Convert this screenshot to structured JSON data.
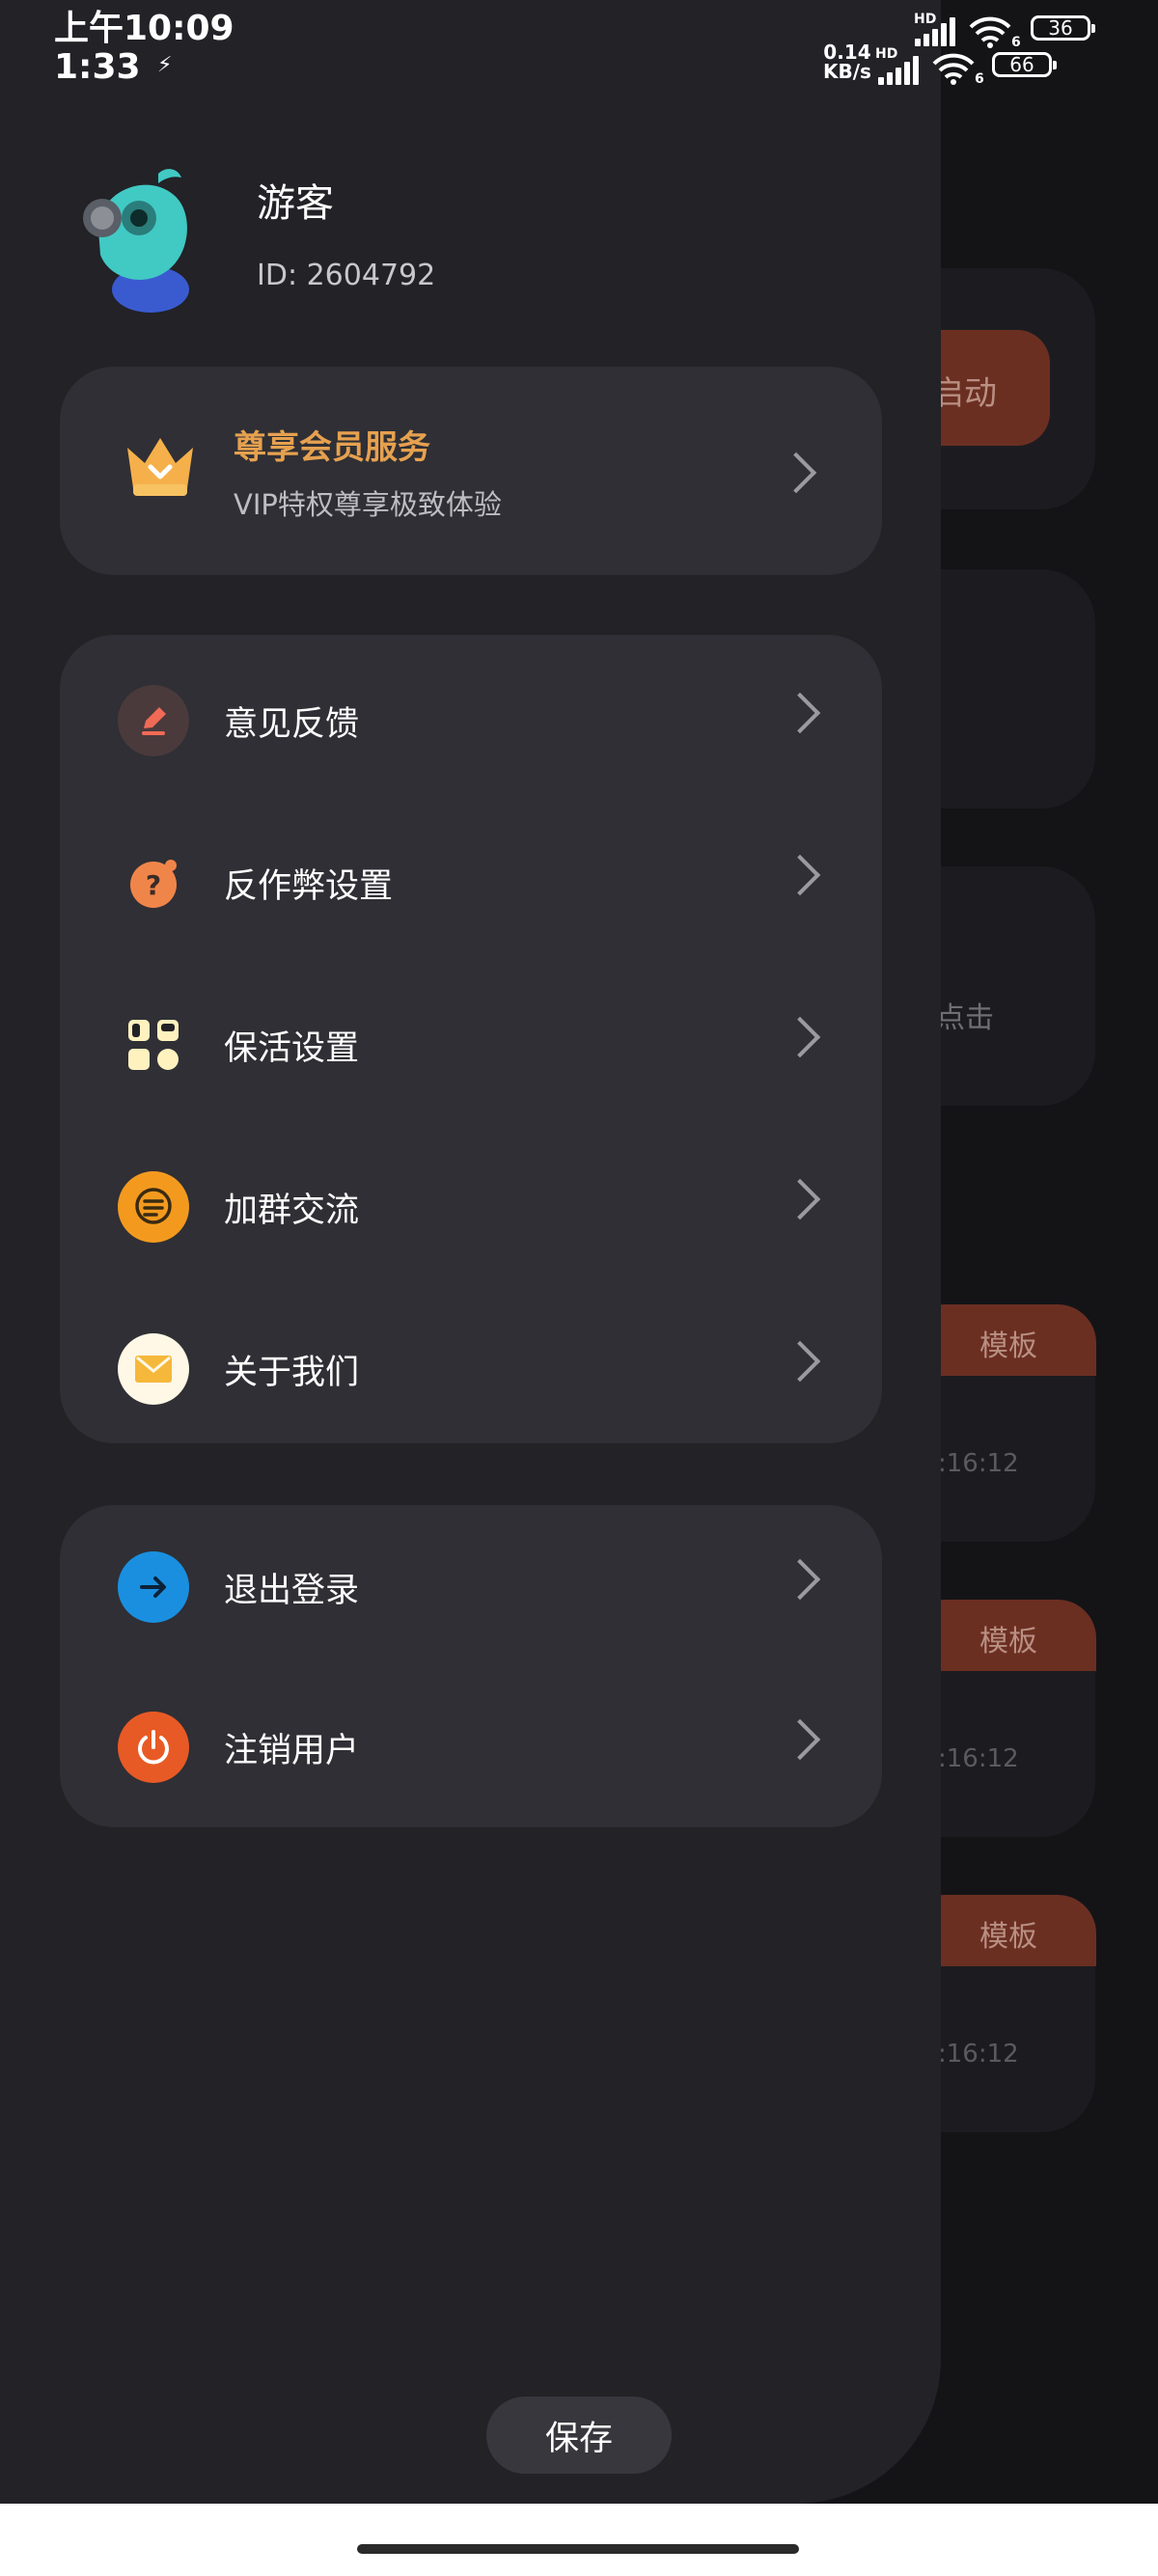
{
  "status_bar": {
    "time_primary": "上午10:09",
    "time_secondary": "1:33",
    "net_speed": "0.14\nKB/s",
    "hd1": "HD",
    "hd2": "HD",
    "wifi_badge": "6",
    "battery1": "36",
    "battery2": "66"
  },
  "profile": {
    "name": "游客",
    "id": "ID: 2604792"
  },
  "vip": {
    "title": "尊享会员服务",
    "subtitle": "VIP特权尊享极致体验",
    "accent": "#e6a14f"
  },
  "menu": {
    "items": [
      {
        "label": "意见反馈",
        "icon": "pencil-icon"
      },
      {
        "label": "反作弊设置",
        "icon": "question-icon"
      },
      {
        "label": "保活设置",
        "icon": "grid-icon"
      },
      {
        "label": "加群交流",
        "icon": "chat-icon"
      },
      {
        "label": "关于我们",
        "icon": "mail-icon"
      }
    ]
  },
  "account": {
    "items": [
      {
        "label": "退出登录",
        "icon": "arrow-right-icon"
      },
      {
        "label": "注销用户",
        "icon": "power-icon"
      }
    ]
  },
  "save_label": "保存",
  "background": {
    "start_label": "启动",
    "click_label": "点击",
    "tag_label": "模板",
    "time_label": ":16:12"
  },
  "colors": {
    "drawer": "#222227",
    "card": "#2f2f35",
    "vip_accent": "#e6a14f",
    "logout_blue": "#1a8fe0",
    "power_orange": "#e85a25"
  }
}
